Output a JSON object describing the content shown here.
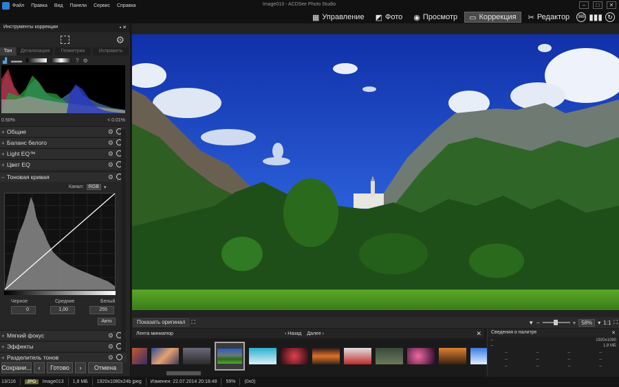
{
  "window": {
    "title": "Image013 - ACDSee Photo Studio",
    "menu": [
      "Файл",
      "Правка",
      "Вид",
      "Панели",
      "Сервис",
      "Справка"
    ]
  },
  "modes": [
    {
      "label": "Управление",
      "icon": "grid-icon",
      "active": false
    },
    {
      "label": "Фото",
      "icon": "photo-icon",
      "active": false
    },
    {
      "label": "Просмотр",
      "icon": "eye-icon",
      "active": false
    },
    {
      "label": "Коррекция",
      "icon": "develop-icon",
      "active": true
    },
    {
      "label": "Редактор",
      "icon": "edit-icon",
      "active": false
    }
  ],
  "mode_extra": {
    "badge_365": "365"
  },
  "left_panel": {
    "title": "Инструменты коррекции",
    "tabs": [
      "Тон",
      "Детализация",
      "Геометрия",
      "Исправить"
    ],
    "clip_left": "0.50%",
    "clip_right": "< 0.01%",
    "sections_top": [
      "Общие",
      "Баланс белого",
      "Light EQ™",
      "Цвет EQ"
    ],
    "tone_curve": {
      "title": "Тоновая кривая",
      "channel_label": "Канал:",
      "channel_value": "RGB",
      "black_label": "Черное",
      "mid_label": "Средние",
      "white_label": "Белый",
      "black_value": "0",
      "mid_value": "1,00",
      "white_value": "255",
      "auto_label": "Авто"
    },
    "sections_bottom": [
      "Мягкий фокус",
      "Эффекты",
      "Разделитель тонов"
    ],
    "buttons": {
      "save": "Сохрани...",
      "done": "Готово",
      "cancel": "Отмена"
    }
  },
  "viewer": {
    "show_original": "Показать оригинал",
    "zoom": "58%",
    "ratio": "1:1"
  },
  "filmstrip": {
    "title": "Лента миниатюр",
    "back": "Назад",
    "forward": "Далее"
  },
  "palette_info": {
    "title": "Сведения о палитре",
    "dimensions": "1920x1080",
    "size": "1,8 МБ",
    "placeholder": "--"
  },
  "status": {
    "count": "13/116",
    "format": "JPG",
    "filename": "Image013",
    "size": "1,8 МБ",
    "dims": "1920x1080x24b jpeg",
    "modified": "Изменен: 22.07.2014 20:18:48",
    "zoom": "59%",
    "coords": "(0x0)"
  }
}
